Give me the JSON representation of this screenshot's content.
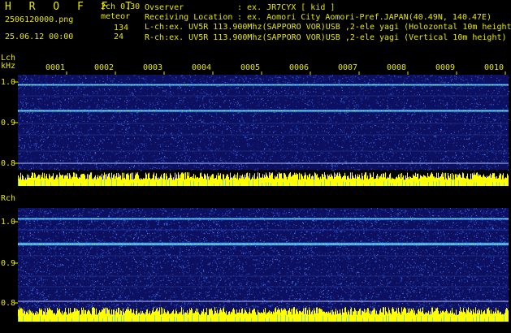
{
  "header": {
    "title": "H R O F F T",
    "version": "2ch 0.30",
    "meteor_label": "meteor",
    "filename": "2506120000.png",
    "datetime": "25.06.12 00:00",
    "lch_count": "134",
    "rch_count": "24",
    "observer_label": "Ovserver",
    "observer_value": ": ex. JR7CYX [ kid ]",
    "location_label": "Receiving Location",
    "location_value": ": ex. Aomori City Aomori-Pref.JAPAN(40.49N, 140.47E)",
    "lch_line": "L-ch:ex. UV5R 113.900Mhz(SAPPORO VOR)USB ,2-ele yagi (Holozontal 10m height)",
    "rch_line": "R-ch:ex. UV5R 113.900Mhz(SAPPORO VOR)USB ,2-ele yagi (Vertical 10m height)"
  },
  "lch_panel": {
    "label": "Lch",
    "unit": "kHz",
    "ticks": [
      "1.0",
      "0.9",
      "0.8"
    ]
  },
  "rch_panel": {
    "label": "Rch",
    "ticks": [
      "1.0",
      "0.9",
      "0.8"
    ]
  },
  "time_marks": [
    "0001",
    "0002",
    "0003",
    "0004",
    "0005",
    "0006",
    "0007",
    "0008",
    "0009",
    "0010"
  ],
  "colors": {
    "text": "#e6e600",
    "background": "#000000",
    "spectrum_bg": "#0d1060",
    "carrier": "#55c8ff",
    "level": "#ffff00"
  }
}
